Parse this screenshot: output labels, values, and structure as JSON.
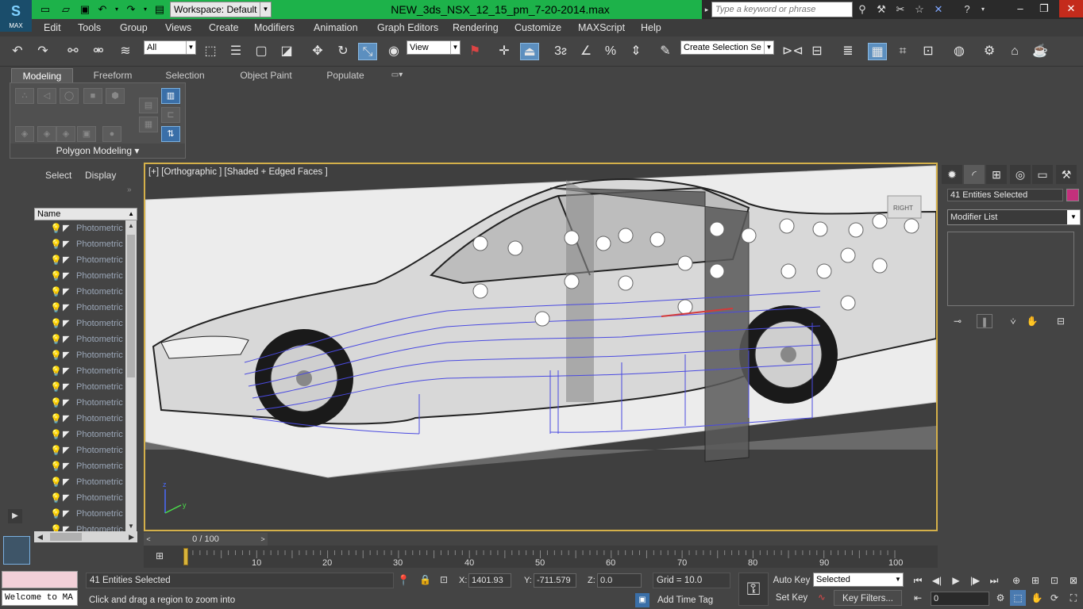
{
  "app": {
    "logo_label": "MAX",
    "workspace": "Workspace: Default",
    "document_title": "NEW_3ds_NSX_12_15_pm_7-20-2014.max",
    "search_placeholder": "Type a keyword or phrase"
  },
  "menu": [
    "Edit",
    "Tools",
    "Group",
    "Views",
    "Create",
    "Modifiers",
    "Animation",
    "Graph Editors",
    "Rendering",
    "Customize",
    "MAXScript",
    "Help"
  ],
  "toolbar": {
    "selection_filter": "All",
    "reference_coord": "View",
    "named_selection_set": "Create Selection Se"
  },
  "ribbon": {
    "tabs": [
      "Modeling",
      "Freeform",
      "Selection",
      "Object Paint",
      "Populate"
    ],
    "active_tab": "Modeling",
    "panel_label": "Polygon Modeling"
  },
  "scene_explorer": {
    "tabs": [
      "Select",
      "Display"
    ],
    "column_header": "Name",
    "items": [
      "Photometric",
      "Photometric",
      "Photometric",
      "Photometric",
      "Photometric",
      "Photometric",
      "Photometric",
      "Photometric",
      "Photometric",
      "Photometric",
      "Photometric",
      "Photometric",
      "Photometric",
      "Photometric",
      "Photometric",
      "Photometric",
      "Photometric",
      "Photometric",
      "Photometric",
      "Photometric"
    ]
  },
  "viewport": {
    "label": "[+] [Orthographic ] [Shaded + Edged Faces ]",
    "viewcube_label": "RIGHT",
    "axis_z": "z",
    "axis_y": "y"
  },
  "command_panel": {
    "selection_name": "41 Entities Selected",
    "object_color": "#c4307c",
    "modifier_list": "Modifier List"
  },
  "timeline": {
    "frame_counter": "0 / 100",
    "ticks": [
      "10",
      "20",
      "30",
      "40",
      "50",
      "60",
      "70",
      "80",
      "90",
      "100"
    ]
  },
  "status": {
    "maxscript_welcome": "Welcome to MA",
    "selection_count": "41 Entities Selected",
    "prompt": "Click and drag a region to zoom into",
    "x_label": "X:",
    "x_value": "1401.93",
    "y_label": "Y:",
    "y_value": "-711.579",
    "z_label": "Z:",
    "z_value": "0.0",
    "grid": "Grid = 10.0",
    "add_time_tag": "Add Time Tag",
    "auto_key": "Auto Key",
    "set_key": "Set Key",
    "key_filters": "Key Filters...",
    "key_mode": "Selected",
    "current_frame": "0"
  }
}
